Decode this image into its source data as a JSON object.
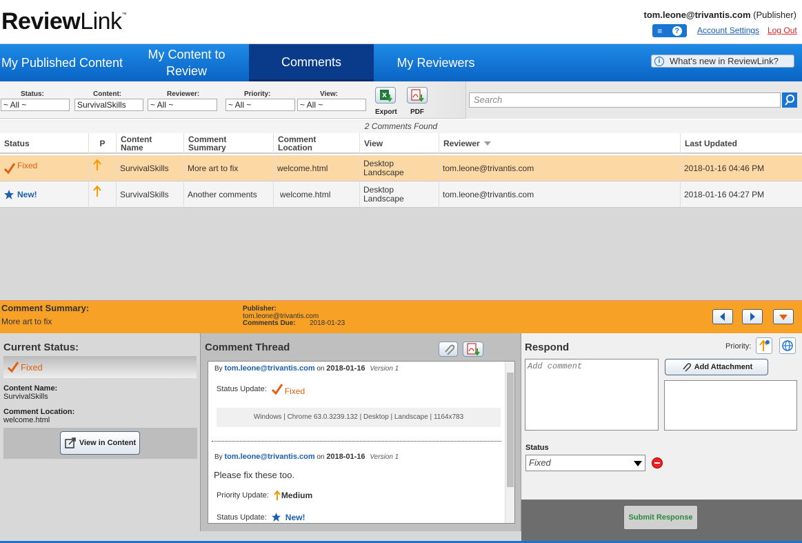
{
  "header": {
    "logo_bold": "Review",
    "logo_light": "Link",
    "logo_tm": "™",
    "user_email": "tom.leone@trivantis.com",
    "user_role": "(Publisher)",
    "menu_icon": "≡",
    "help_icon": "?",
    "account_settings": "Account Settings",
    "log_out": "Log Out"
  },
  "nav": {
    "tabs": [
      {
        "label": "My Published Content"
      },
      {
        "label": "My Content to Review"
      },
      {
        "label": "Comments",
        "active": true
      },
      {
        "label": "My Reviewers"
      }
    ],
    "whats_new": "What's new in ReviewLink?",
    "whats_new_icon": "i"
  },
  "filters": {
    "status_label": "Status:",
    "status_value": "~ All ~",
    "content_label": "Content:",
    "content_value": "SurvivalSkills",
    "reviewer_label": "Reviewer:",
    "reviewer_value": "~ All ~",
    "priority_label": "Priority:",
    "priority_value": "~ All ~",
    "view_label": "View:",
    "view_value": "~ All ~",
    "export_label": "Export",
    "pdf_label": "PDF"
  },
  "search": {
    "placeholder": "Search"
  },
  "results": {
    "count_text": "2 Comments Found"
  },
  "table": {
    "headers": {
      "status": "Status",
      "priority": "P",
      "content_name": "Content Name",
      "comment_summary": "Comment Summary",
      "comment_location": "Comment Location",
      "view": "View",
      "reviewer": "Reviewer",
      "last_updated": "Last Updated"
    },
    "rows": [
      {
        "status": "Fixed",
        "content_name": "SurvivalSkills",
        "summary": "More art to fix",
        "location": "welcome.html",
        "view": "Desktop Landscape",
        "reviewer": "tom.leone@trivantis.com",
        "updated": "2018-01-16 04:46 PM"
      },
      {
        "status": "New!",
        "content_name": "SurvivalSkills",
        "summary": "Another comments",
        "location": "welcome.html",
        "view": "Desktop Landscape",
        "reviewer": "tom.leone@trivantis.com",
        "updated": "2018-01-16 04:27 PM"
      }
    ]
  },
  "summary": {
    "label": "Comment Summary:",
    "value": "More art to fix",
    "publisher_label": "Publisher:",
    "publisher_value": "tom.leone@trivantis.com",
    "due_label": "Comments Due:",
    "due_value": "2018-01-23"
  },
  "current": {
    "title": "Current Status:",
    "status": "Fixed",
    "content_name_label": "Content Name:",
    "content_name": "SurvivalSkills",
    "location_label": "Comment Location:",
    "location": "welcome.html",
    "view_in_content": "View in Content"
  },
  "thread": {
    "title": "Comment Thread",
    "entries": [
      {
        "by": "By",
        "author": "tom.leone@trivantis.com",
        "on": "on",
        "date": "2018-01-16",
        "version": "Version 1",
        "status_update_label": "Status Update:",
        "status_update": "Fixed",
        "env": "Windows | Chrome 63.0.3239.132 | Desktop | Landscape | 1164x783"
      },
      {
        "by": "By",
        "author": "tom.leone@trivantis.com",
        "on": "on",
        "date": "2018-01-16",
        "version": "Version 1",
        "message": "Please fix these too.",
        "priority_update_label": "Priority Update:",
        "priority_update": "Medium",
        "status_update_label": "Status Update:",
        "status_update": "New!"
      }
    ]
  },
  "respond": {
    "title": "Respond",
    "priority_label": "Priority:",
    "comment_placeholder": "Add comment",
    "add_attachment": "Add Attachment",
    "status_label": "Status",
    "status_value": "Fixed",
    "submit": "Submit Response"
  },
  "colors": {
    "nav_blue": "#0a64c4",
    "active_tab": "#0a3a8a",
    "selected_row": "#fcd9a4",
    "summary_orange": "#f7a127",
    "fixed_orange": "#e06010",
    "new_blue": "#1a5fb4"
  }
}
